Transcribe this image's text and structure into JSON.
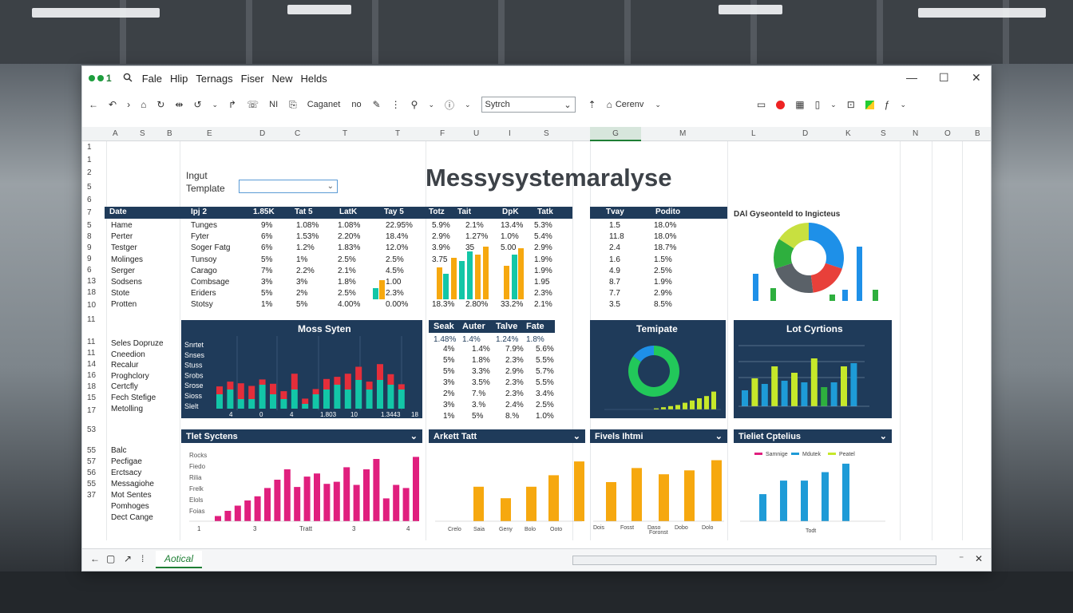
{
  "window": {
    "app_icon_text": "1",
    "menu": [
      "Fale",
      "Hlip",
      "Ternags",
      "Fiser",
      "New",
      "Helds"
    ],
    "controls": {
      "minimize": "—",
      "maximize": "☐",
      "close": "✕"
    }
  },
  "toolbar": {
    "label_1": "Caganet",
    "label_2": "no",
    "search_value": "Sytrch",
    "label_3": "Cerenv",
    "label_4": "NI"
  },
  "columns": [
    "A",
    "S",
    "B",
    "E",
    "D",
    "C",
    "T",
    "T",
    "F",
    "U",
    "I",
    "S",
    "G",
    "M",
    "L",
    "D",
    "K",
    "S",
    "N",
    "O",
    "B"
  ],
  "row_numbers": [
    "1",
    "1",
    "2",
    "5",
    "6",
    "7",
    "5",
    "8",
    "9",
    "9",
    "6",
    "13",
    "18",
    "10",
    "11",
    "11",
    "11",
    "14",
    "16",
    "18",
    "15",
    "17",
    "53",
    "55",
    "57",
    "56",
    "55",
    "37"
  ],
  "input": {
    "label_1": "Ingut",
    "label_2": "Template"
  },
  "title": "Messysystemaralyse",
  "table1": {
    "headers": [
      "Date",
      "Ipj 2",
      "1.85K",
      "Tat 5",
      "LatK",
      "Tay 5",
      "Totz",
      "Tait",
      "DpK",
      "Tatk",
      "",
      "Tvay",
      "Podito"
    ],
    "rows": [
      {
        "label": "Hame",
        "cols": [
          "Tunges",
          "9%",
          "1.08%",
          "1.08%",
          "22.95%",
          "5.9%",
          "2.1%",
          "13.4%",
          "5.3%",
          "",
          "1.5",
          "18.0%"
        ]
      },
      {
        "label": "Perter",
        "cols": [
          "Fyter",
          "6%",
          "1.53%",
          "2.20%",
          "18.4%",
          "2.9%",
          "1.27%",
          "1.0%",
          "5.4%",
          "",
          "11.8",
          "18.0%"
        ]
      },
      {
        "label": "Testger",
        "cols": [
          "Soger Fatg",
          "6%",
          "1.2%",
          "1.83%",
          "12.0%",
          "3.9%",
          "35",
          "5.00",
          "2.9%",
          "",
          "2.4",
          "18.7%"
        ]
      },
      {
        "label": "Molinges",
        "cols": [
          "Tunsoy",
          "5%",
          "1%",
          "2.5%",
          "2.5%",
          "3.75",
          "",
          "",
          "1.9%",
          "",
          "1.6",
          "1.5%"
        ]
      },
      {
        "label": "Serger",
        "cols": [
          "Carago",
          "7%",
          "2.2%",
          "2.1%",
          "4.5%",
          "",
          "",
          "",
          "1.9%",
          "",
          "4.9",
          "2.5%"
        ]
      },
      {
        "label": "Sodsens",
        "cols": [
          "Combsage",
          "3%",
          "3%",
          "1.8%",
          "1.00",
          "",
          "",
          "",
          "1.95",
          "",
          "8.7",
          "1.9%"
        ]
      },
      {
        "label": "Stote",
        "cols": [
          "Eriders",
          "5%",
          "2%",
          "2.5%",
          "2.3%",
          "",
          "",
          "",
          "2.3%",
          "",
          "7.7",
          "2.9%"
        ]
      },
      {
        "label": "Protten",
        "cols": [
          "Stotsy",
          "1%",
          "5%",
          "4.00%",
          "0.00%",
          "18.3%",
          "2.80%",
          "33.2%",
          "2.1%",
          "",
          "3.5",
          "8.5%"
        ]
      }
    ]
  },
  "chart_mini_pie": {
    "title": "DAl Gyseonteld to Ingicteus"
  },
  "row_labels_2": [
    "Seles Dopruze",
    "Cneedion",
    "Recalur",
    "Proghclory",
    "Certcfly",
    "Fech Stefige",
    "Metolling"
  ],
  "panel_1": {
    "title": "Moss Syten",
    "rows": [
      "Snrtet",
      "Snses",
      "Stuss",
      "Srobs",
      "Srose",
      "Sioss",
      "Slelt"
    ],
    "x_ticks": [
      "4",
      "0",
      "4",
      "1.803",
      "10",
      "1.3443",
      "18"
    ]
  },
  "table2": {
    "headers": [
      "Seak",
      "Auter",
      "Talve",
      "Fate"
    ],
    "subhdr": [
      "1.48%",
      "1.4%",
      "1.24%",
      "1.8%"
    ],
    "rows": [
      [
        "4%",
        "1.4%",
        "7.9%",
        "5.6%"
      ],
      [
        "5%",
        "1.8%",
        "2.3%",
        "5.5%"
      ],
      [
        "5%",
        "3.3%",
        "2.9%",
        "5.7%"
      ],
      [
        "3%",
        "3.5%",
        "2.3%",
        "5.5%"
      ],
      [
        "2%",
        "7.%",
        "2.3%",
        "3.4%"
      ],
      [
        "3%",
        "3.%",
        "2.4%",
        "2.5%"
      ],
      [
        "1%",
        "5%",
        "8.%",
        "1.0%"
      ]
    ]
  },
  "panel_2": {
    "title": "Temipate"
  },
  "panel_3": {
    "title": "Lot Cyrtions"
  },
  "row_labels_3": [
    "Balc",
    "Pecfigae",
    "Erctsacy",
    "Messagiohe",
    "Mot Sentes",
    "Pomhoges",
    "Dect Cange"
  ],
  "bottom_1": {
    "title": "Tlet Syctens",
    "rows": [
      "Rocks",
      "Fiedo",
      "Rilia",
      "Frelk",
      "Elols",
      "Foias"
    ],
    "x_ticks": [
      "1",
      "3",
      "Tratt",
      "3",
      "4"
    ]
  },
  "bottom_2": {
    "title": "Arkett Tatt",
    "x_ticks": [
      "Crelo",
      "Saia",
      "Geny",
      "Bolo",
      "Ooto",
      "Dois",
      "Fosst",
      "Daso",
      "Dobo",
      "Dolo"
    ]
  },
  "bottom_3": {
    "title": "Fivels Ihtmi",
    "x_label": "Foronst"
  },
  "bottom_4": {
    "title": "Tieliet Cptelius",
    "legend": [
      "Samnige",
      "Mdutek",
      "Peatel"
    ],
    "x_label": "Todt"
  },
  "sheetbar": {
    "tab": "Aotical"
  },
  "chart_data": [
    {
      "type": "bar",
      "title": "Moss Syten",
      "series": [
        {
          "name": "",
          "values": [
            3,
            4,
            2,
            2,
            5,
            3,
            2,
            4,
            1,
            3,
            4,
            5,
            4,
            6,
            4,
            6,
            5,
            4
          ]
        },
        {
          "name": "",
          "values": [
            3,
            3,
            6,
            5,
            2,
            4,
            3,
            6,
            2,
            2,
            4,
            3,
            6,
            5,
            3,
            6,
            4,
            2
          ]
        }
      ]
    },
    {
      "type": "bar",
      "title": "Tlet Syctens",
      "values": [
        0.5,
        1,
        1.5,
        2,
        2.4,
        3.2,
        4,
        5,
        3.3,
        4.3,
        4.6,
        3.6,
        3.8,
        5.2,
        3.5,
        5,
        6,
        2.2,
        3.5,
        3.2,
        6.2
      ]
    },
    {
      "type": "bar",
      "title": "Arkett Tatt",
      "values": [
        4.5,
        3,
        4.5,
        6,
        7.8
      ]
    },
    {
      "type": "bar",
      "title": "Fivels Ihtmi",
      "values": [
        5,
        6.8,
        6,
        6.5,
        7.8
      ]
    },
    {
      "type": "bar",
      "title": "Tieliet Cptelius",
      "values": [
        3.2,
        4.8,
        4.8,
        5.8,
        6.8
      ]
    },
    {
      "type": "pie",
      "title": "DAl Gyseonteld to Ingicteus",
      "series": [
        {
          "name": "",
          "values": [
            30,
            18,
            22,
            14,
            16
          ]
        }
      ],
      "colors": [
        "#1e90e8",
        "#e8403a",
        "#5a6168",
        "#2eaf3e",
        "#c8e040"
      ]
    },
    {
      "type": "pie",
      "title": "Temipate",
      "values": [
        85,
        15
      ],
      "colors": [
        "#22c85a",
        "#1e90e8"
      ]
    }
  ],
  "colors": {
    "navy": "#1f3b5a",
    "accent_green": "#1e7e34",
    "pink": "#e01f7e",
    "orange": "#f6a80f",
    "blue": "#1e9bd7",
    "lime": "#c6e82a",
    "teal": "#13c6a7",
    "red": "#e42e3a"
  }
}
